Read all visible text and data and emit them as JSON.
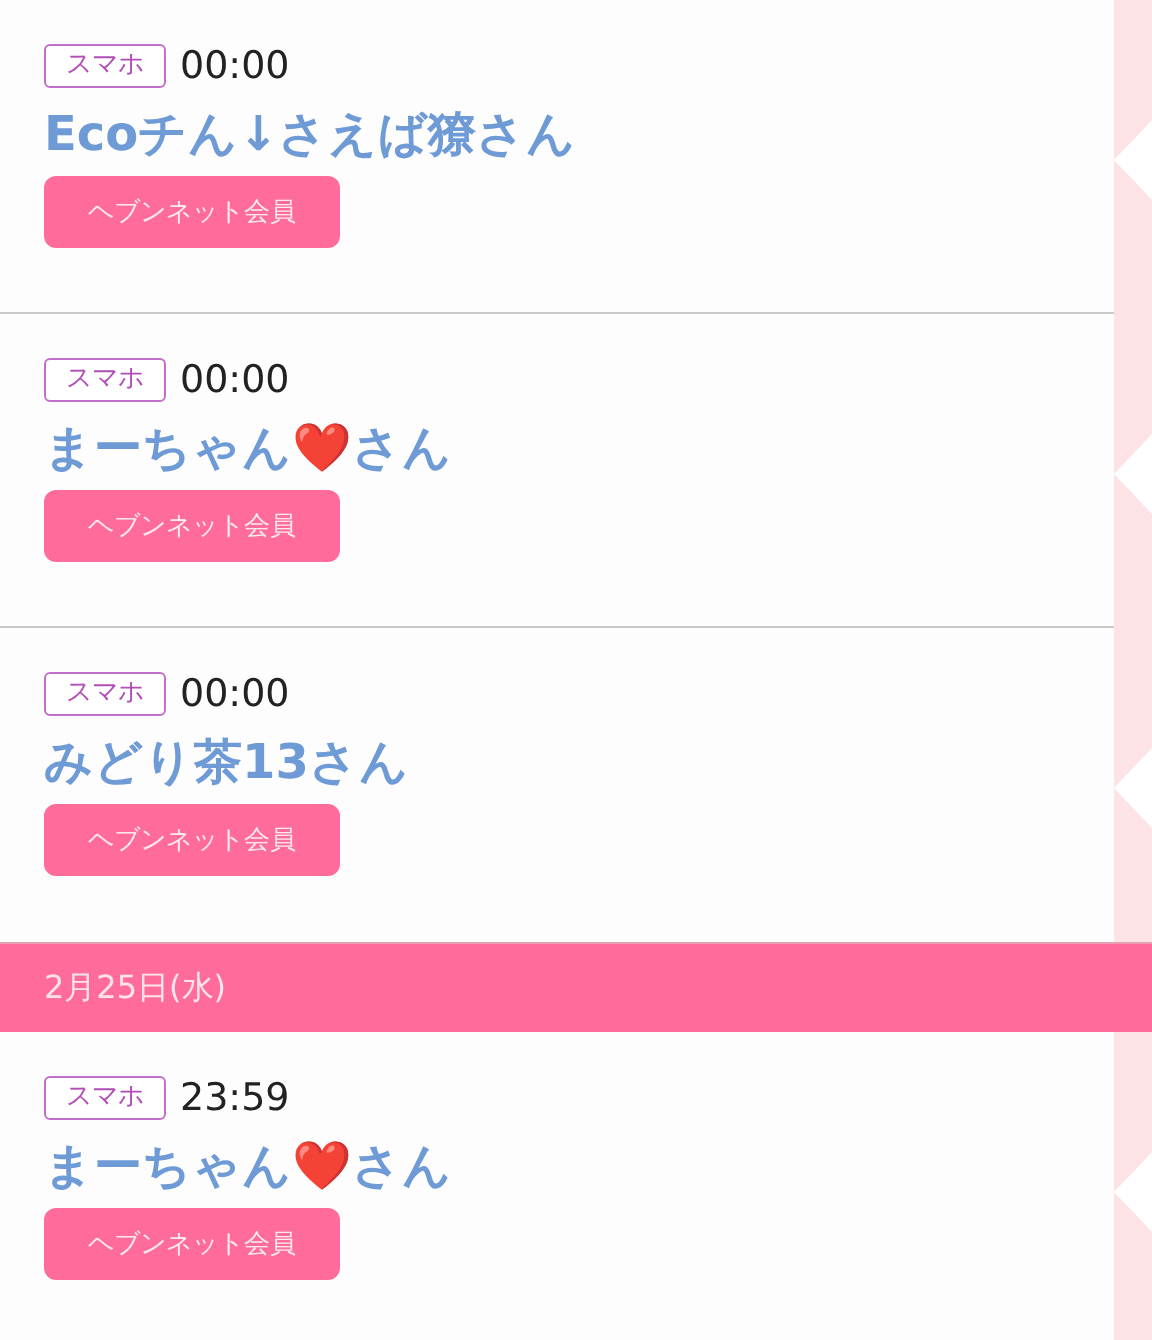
{
  "items": [
    {
      "kind": "entry",
      "device": "スマホ",
      "time": "00:00",
      "name": "Ecoチん↓さえば獠さん",
      "badge": "ヘブンネット会員"
    },
    {
      "kind": "entry",
      "device": "スマホ",
      "time": "00:00",
      "name": "まーちゃん❤️さん",
      "badge": "ヘブンネット会員"
    },
    {
      "kind": "entry",
      "device": "スマホ",
      "time": "00:00",
      "name": "みどり茶13さん",
      "badge": "ヘブンネット会員"
    },
    {
      "kind": "date",
      "label": "2月25日(水)"
    },
    {
      "kind": "entry",
      "device": "スマホ",
      "time": "23:59",
      "name": "まーちゃん❤️さん",
      "badge": "ヘブンネット会員"
    }
  ]
}
